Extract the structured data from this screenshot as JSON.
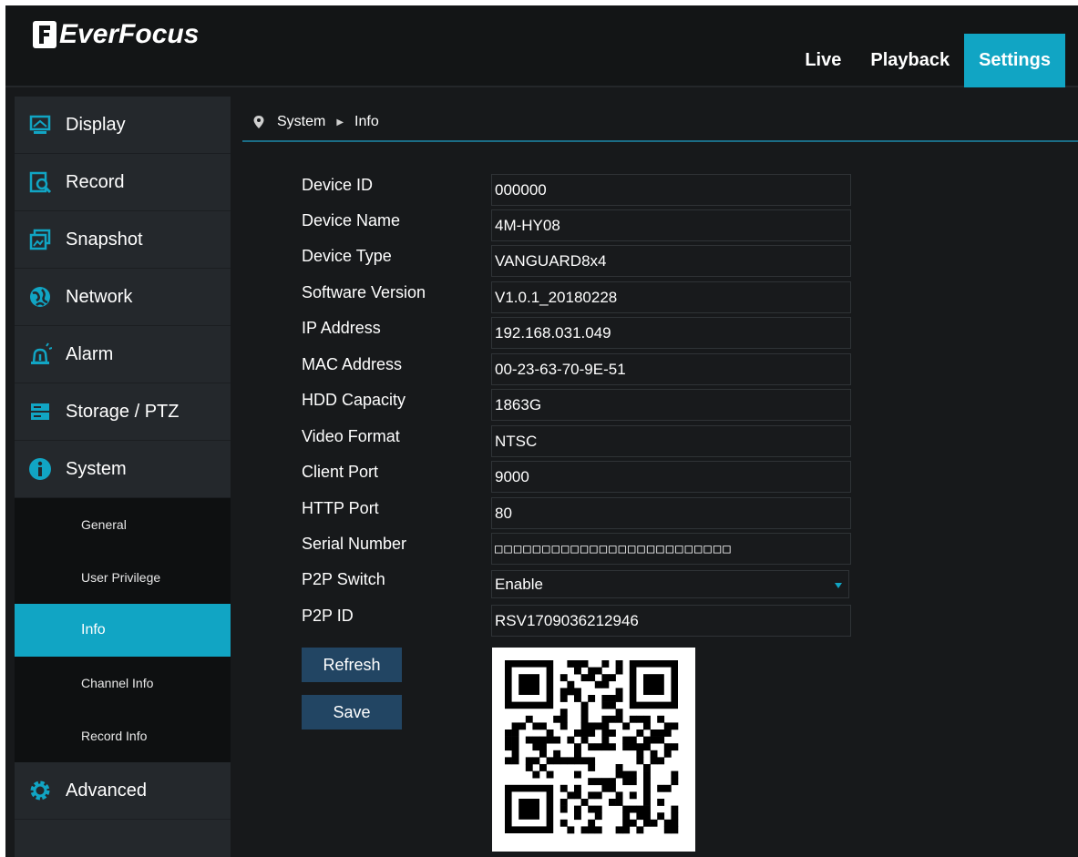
{
  "header": {
    "logo_text": "EverFocus",
    "tabs": [
      {
        "label": "Live"
      },
      {
        "label": "Playback"
      },
      {
        "label": "Settings"
      }
    ]
  },
  "sidebar": {
    "items": [
      {
        "label": "Display",
        "icon": "display-icon"
      },
      {
        "label": "Record",
        "icon": "record-icon"
      },
      {
        "label": "Snapshot",
        "icon": "snapshot-icon"
      },
      {
        "label": "Network",
        "icon": "network-icon"
      },
      {
        "label": "Alarm",
        "icon": "alarm-icon"
      },
      {
        "label": "Storage / PTZ",
        "icon": "storage-icon"
      },
      {
        "label": "System",
        "icon": "info-icon"
      },
      {
        "label": "Advanced",
        "icon": "gear-icon"
      }
    ],
    "system_sub_items": [
      {
        "label": "General"
      },
      {
        "label": "User Privilege"
      },
      {
        "label": "Info"
      },
      {
        "label": "Channel Info"
      },
      {
        "label": "Record Info"
      }
    ]
  },
  "breadcrumb": {
    "section": "System",
    "page": "Info"
  },
  "form": {
    "device_id": {
      "label": "Device ID",
      "value": "000000"
    },
    "device_name": {
      "label": "Device Name",
      "value": "4M-HY08"
    },
    "device_type": {
      "label": "Device Type",
      "value": "VANGUARD8x4"
    },
    "software_version": {
      "label": "Software Version",
      "value": "V1.0.1_20180228"
    },
    "ip_address": {
      "label": "IP Address",
      "value": "192.168.031.049"
    },
    "mac_address": {
      "label": "MAC Address",
      "value": "00-23-63-70-9E-51"
    },
    "hdd_capacity": {
      "label": "HDD Capacity",
      "value": "1863G"
    },
    "video_format": {
      "label": "Video Format",
      "value": "NTSC"
    },
    "client_port": {
      "label": "Client Port",
      "value": "9000"
    },
    "http_port": {
      "label": "HTTP Port",
      "value": "80"
    },
    "serial_number": {
      "label": "Serial Number",
      "value": "□□□□□□□□□□□□□□□□□□□□□□□□□"
    },
    "p2p_switch": {
      "label": "P2P Switch",
      "value": "Enable"
    },
    "p2p_id": {
      "label": "P2P ID",
      "value": "RSV1709036212946"
    }
  },
  "buttons": {
    "refresh": "Refresh",
    "save": "Save"
  },
  "colors": {
    "accent": "#11a5c4",
    "button": "#224563",
    "background": "#17191b",
    "sidebar": "#24282c"
  }
}
